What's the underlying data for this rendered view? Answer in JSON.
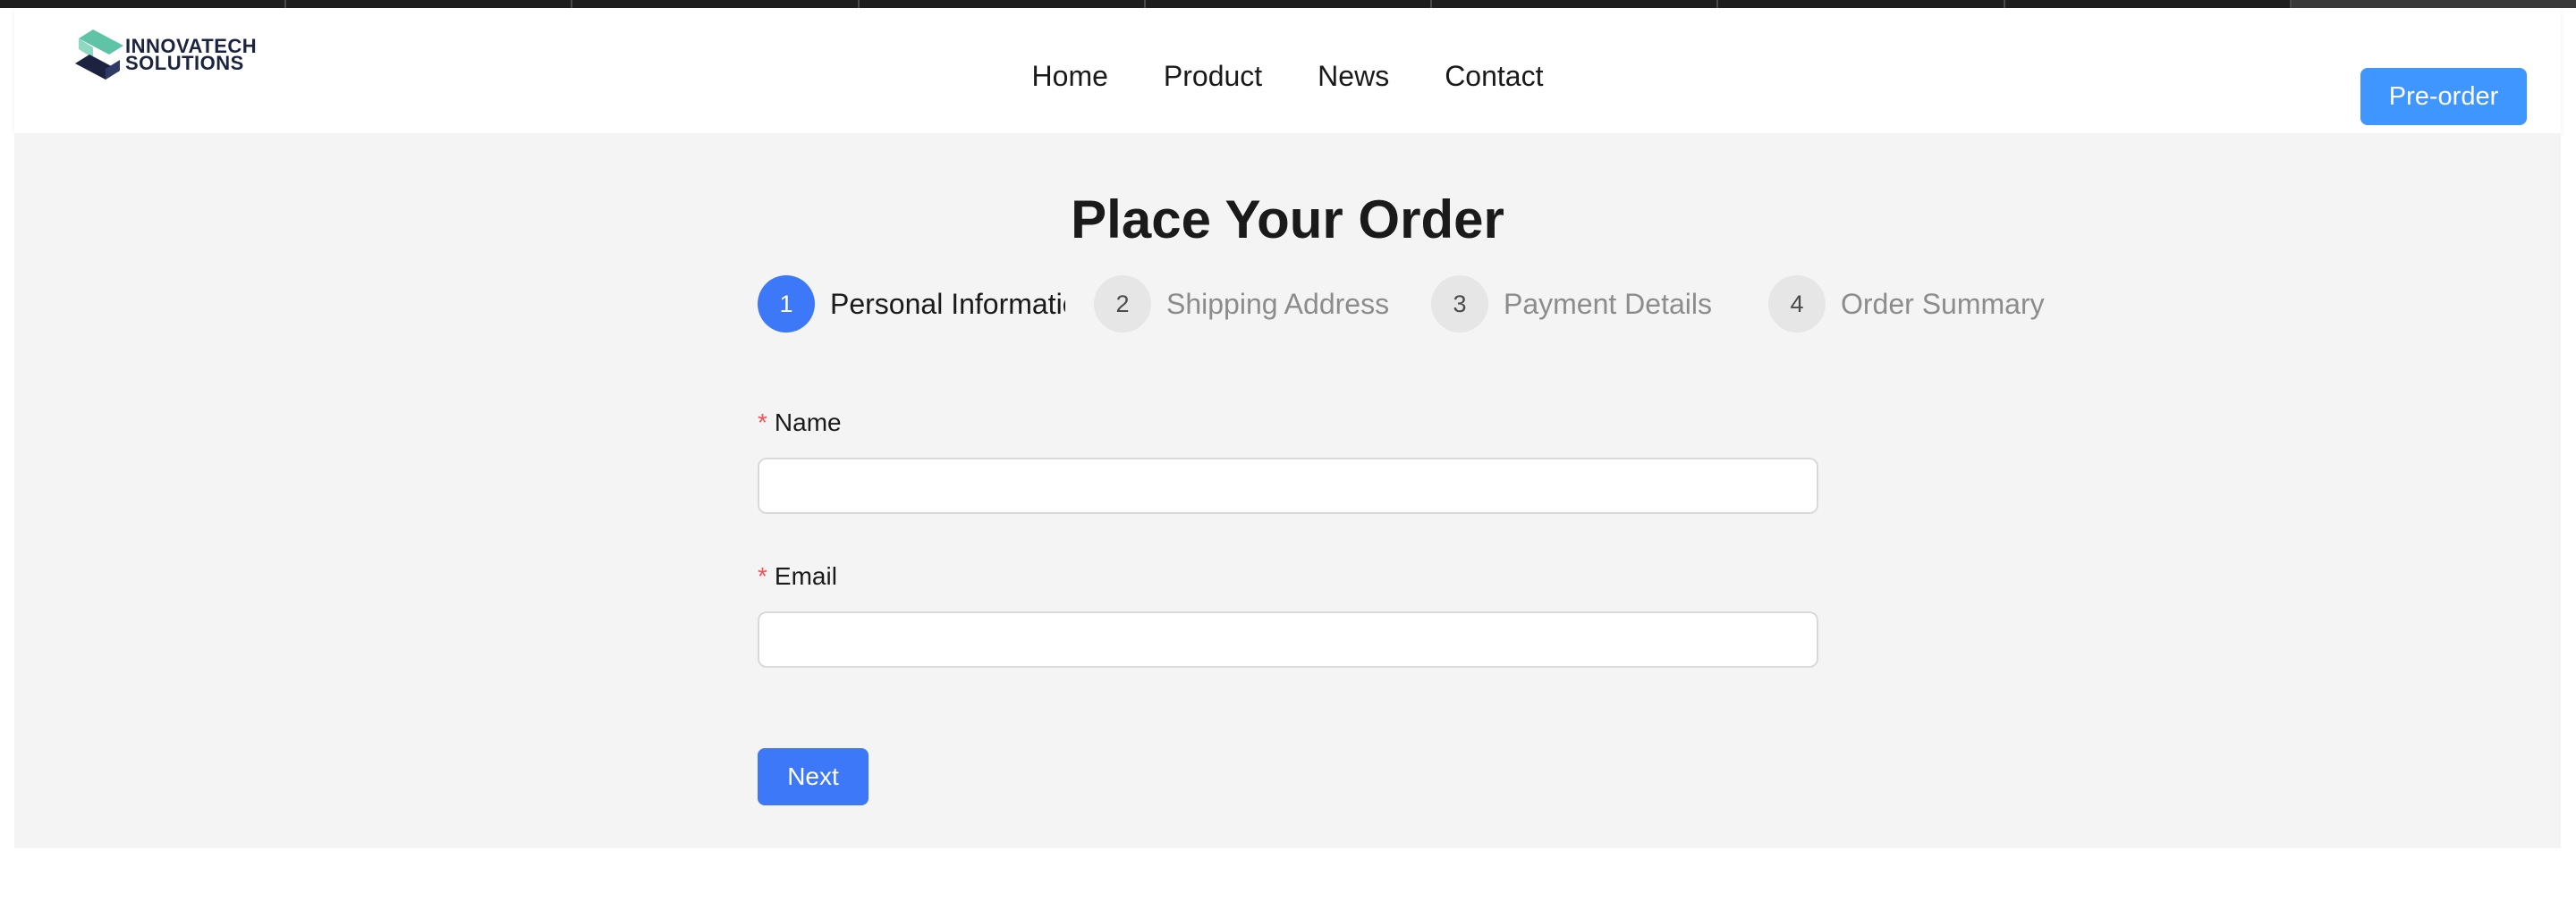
{
  "brand": {
    "line1": "INNOVATECH",
    "line2": "SOLUTIONS",
    "colors": {
      "mark_light": "#5fc3a6",
      "mark_dark": "#1b2340"
    }
  },
  "nav": {
    "items": [
      {
        "label": "Home"
      },
      {
        "label": "Product"
      },
      {
        "label": "News"
      },
      {
        "label": "Contact"
      }
    ],
    "cta_label": "Pre-order"
  },
  "page": {
    "title": "Place Your Order"
  },
  "steps": [
    {
      "number": "1",
      "label": "Personal Information",
      "status": "active"
    },
    {
      "number": "2",
      "label": "Shipping Address",
      "status": "wait"
    },
    {
      "number": "3",
      "label": "Payment Details",
      "status": "wait"
    },
    {
      "number": "4",
      "label": "Order Summary",
      "status": "wait"
    }
  ],
  "form": {
    "required_mark": "*",
    "name": {
      "label": "Name",
      "value": "",
      "placeholder": ""
    },
    "email": {
      "label": "Email",
      "value": "",
      "placeholder": ""
    },
    "next_label": "Next"
  },
  "colors": {
    "primary": "#3c78f7",
    "cta": "#4096ff",
    "required": "#ff4d4f",
    "background": "#f4f4f4"
  }
}
